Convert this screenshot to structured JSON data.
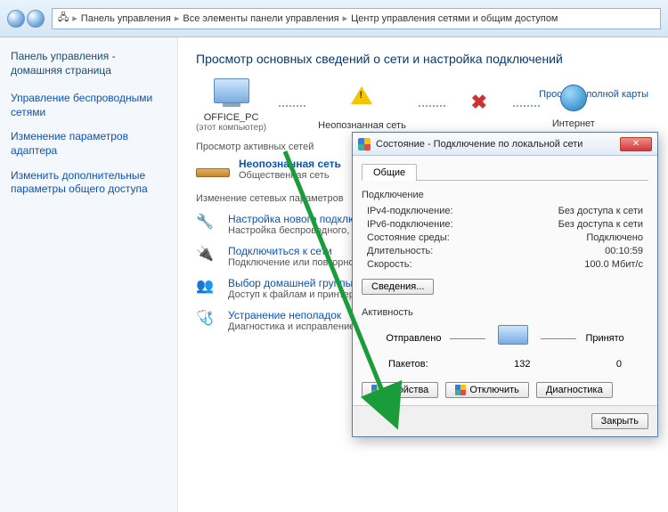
{
  "breadcrumb": {
    "p1": "Панель управления",
    "p2": "Все элементы панели управления",
    "p3": "Центр управления сетями и общим доступом"
  },
  "sidebar": {
    "home": "Панель управления - домашняя страница",
    "links": [
      "Управление беспроводными сетями",
      "Изменение параметров адаптера",
      "Изменить дополнительные параметры общего доступа"
    ]
  },
  "heading": "Просмотр основных сведений о сети и настройка подключений",
  "map": {
    "pc_name": "OFFICE_PC",
    "pc_sub": "(этот компьютер)",
    "unknown": "Неопознанная сеть",
    "internet": "Интернет",
    "full_map": "Просмотр полной карты"
  },
  "sections": {
    "active": "Просмотр активных сетей",
    "tasks": "Изменение сетевых параметров"
  },
  "active_net": {
    "title": "Неопознанная сеть",
    "type": "Общественная сеть"
  },
  "tasks": [
    {
      "title": "Настройка нового подключения",
      "desc": "Настройка беспроводного, широкополосного или же настройка маршрутизатора"
    },
    {
      "title": "Подключиться к сети",
      "desc": "Подключение или повторное подключение к сетевому соединении или подкл."
    },
    {
      "title": "Выбор домашней группы и параметров",
      "desc": "Доступ к файлам и принтерам, изменение параметров общего доступа"
    },
    {
      "title": "Устранение неполадок",
      "desc": "Диагностика и исправление сетевых неполадок"
    }
  ],
  "dialog": {
    "title": "Состояние - Подключение по локальной сети",
    "tab": "Общие",
    "connection_label": "Подключение",
    "rows": {
      "ipv4_k": "IPv4-подключение:",
      "ipv4_v": "Без доступа к сети",
      "ipv6_k": "IPv6-подключение:",
      "ipv6_v": "Без доступа к сети",
      "media_k": "Состояние среды:",
      "media_v": "Подключено",
      "dur_k": "Длительность:",
      "dur_v": "00:10:59",
      "speed_k": "Скорость:",
      "speed_v": "100.0 Мбит/с"
    },
    "details_btn": "Сведения...",
    "activity_label": "Активность",
    "sent": "Отправлено",
    "recv": "Принято",
    "pkts_label": "Пакетов:",
    "sent_val": "132",
    "recv_val": "0",
    "btn_props": "Свойства",
    "btn_disable": "Отключить",
    "btn_diag": "Диагностика",
    "btn_close": "Закрыть"
  }
}
